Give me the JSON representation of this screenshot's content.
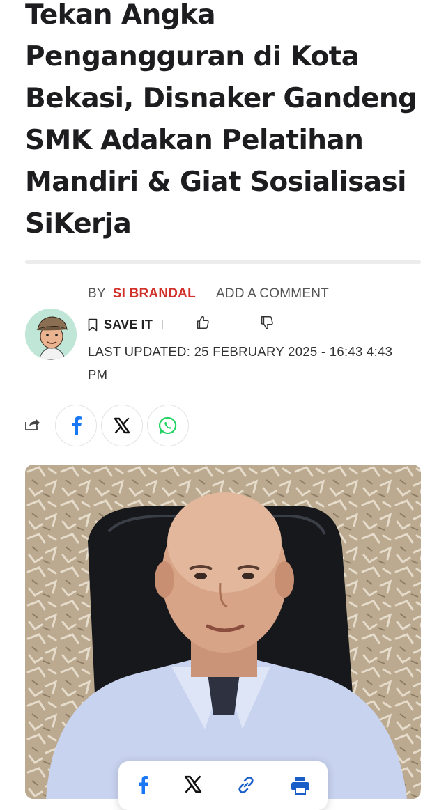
{
  "article": {
    "title": "Tekan Angka Pengangguran di Kota Bekasi, Disnaker Gandeng SMK Adakan Pelatihan Mandiri & Giat Sosialisasi SiKerja"
  },
  "byline": {
    "by_label": "BY",
    "author": "SI BRANDAL",
    "comment_label": "ADD A COMMENT",
    "save_label": "SAVE IT",
    "updated": "LAST UPDATED: 25 FEBRUARY 2025 - 16:43 4:43 PM"
  },
  "share": {
    "icons": [
      "share-icon",
      "facebook-icon",
      "x-icon",
      "whatsapp-icon"
    ]
  },
  "floating_share": {
    "icons": [
      "facebook-icon",
      "x-icon",
      "link-icon",
      "print-icon"
    ]
  },
  "colors": {
    "author": "#d2312b",
    "facebook": "#1877f2",
    "whatsapp": "#25d366",
    "print": "#1a5fc8"
  }
}
